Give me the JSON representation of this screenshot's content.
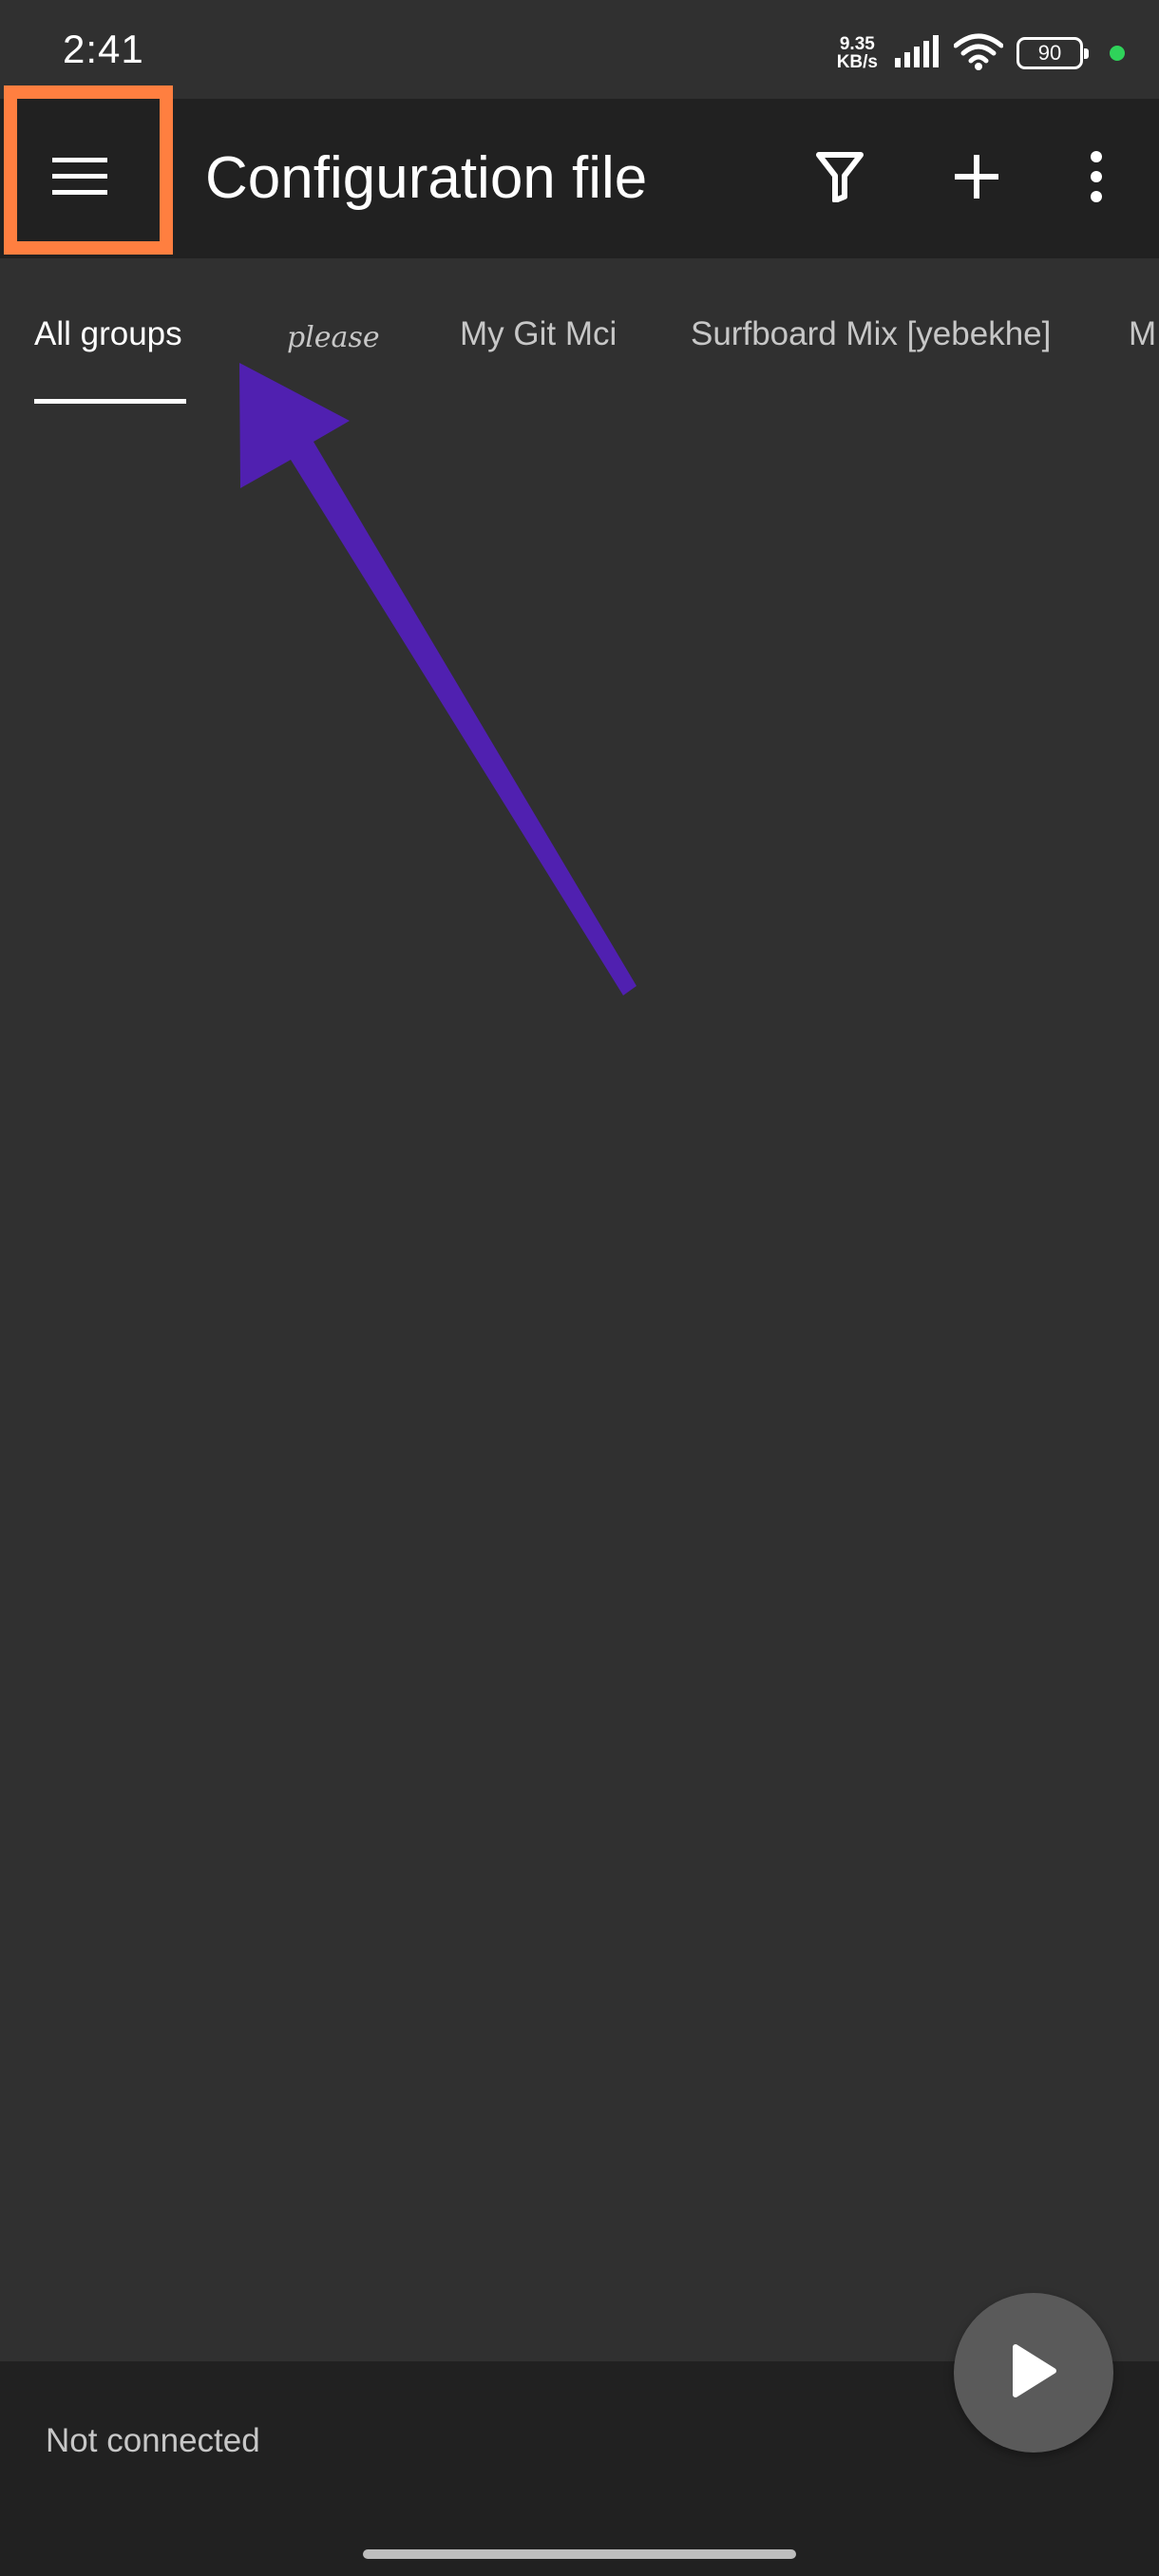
{
  "status_bar": {
    "time": "2:41",
    "net_speed_value": "9.35",
    "net_speed_unit": "KB/s",
    "battery_level": "90",
    "icons": [
      "signal-icon",
      "wifi-icon",
      "battery-icon",
      "charging-dot-icon"
    ]
  },
  "app_bar": {
    "title": "Configuration file",
    "icons": [
      "menu-icon",
      "filter-icon",
      "add-icon",
      "more-vert-icon"
    ]
  },
  "tabs": {
    "items": [
      {
        "label": "All groups",
        "active": true
      },
      {
        "label": "please",
        "active": false
      },
      {
        "label": "My Git Mci",
        "active": false
      },
      {
        "label": "Surfboard Mix [yebekhe]",
        "active": false
      },
      {
        "label": "M",
        "active": false
      }
    ]
  },
  "bottom_bar": {
    "connection_status": "Not connected",
    "fab_icon": "play-icon"
  },
  "colors": {
    "background": "#303030",
    "app_bar": "#212121",
    "highlight_box": "#ff7f40",
    "arrow": "#5020b0",
    "fab": "#5a5a5a",
    "charge_dot": "#2fd35a"
  }
}
